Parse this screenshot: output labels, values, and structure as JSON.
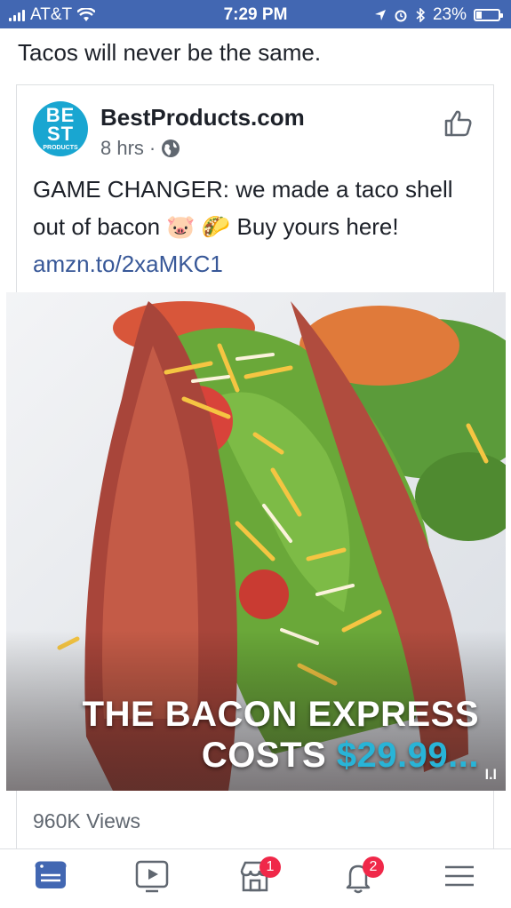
{
  "status_bar": {
    "carrier": "AT&T",
    "time": "7:29 PM",
    "battery": "23%"
  },
  "share_text": "Tacos will never be the same.",
  "post": {
    "page_name": "BestProducts.com",
    "avatar_text_big": "BE ST",
    "avatar_text_small": "PRODUCTS",
    "time_ago": "8 hrs",
    "separator": "·",
    "text_before": "GAME CHANGER: we made a taco shell out of bacon 🐷 🌮 Buy yours here! ",
    "link": "amzn.to/2xaMKC1"
  },
  "video": {
    "caption_line1": "THE BACON EXPRESS",
    "caption_line2_text": "COSTS ",
    "caption_line2_price": "$29.99...",
    "watermark": "l.l"
  },
  "views": "960K Views",
  "nav": {
    "marketplace_badge": "1",
    "notifications_badge": "2"
  },
  "colors": {
    "facebook_blue": "#4267b2",
    "link_blue": "#385898",
    "badge_red": "#f02849",
    "price_cyan": "#28b4d7"
  }
}
